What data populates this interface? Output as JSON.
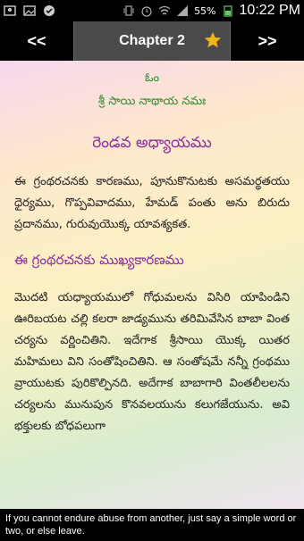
{
  "status": {
    "battery": "55%",
    "time": "10:22 PM"
  },
  "toolbar": {
    "prev_label": "<<",
    "title": "Chapter 2",
    "next_label": ">>"
  },
  "content": {
    "om": "ఓం",
    "mantra": "శ్రీ సాయి నాథాయ నమః",
    "chapter_heading": "రెండవ అధ్యాయము",
    "para1": "ఈ గ్రంథరచనకు కారణము, పూనుకొనుటకు అసమర్థతయు ధైర్యము, గొప్పవివాదము, హేమడ్ పంతు అను బిరుదు ప్రదానము, గురువుయొక్క యావశ్యకత.",
    "section_heading": "ఈ గ్రంథరచనకు ముఖ్యకారణము",
    "para2": "మొదటి యధ్యాయములో గోధుమలను విసిరి యాపిండిని ఊరిబయట చల్లి కలరా జాడ్యమును తరిమివేసిన బాబా వింత చర్యను వర్ణించితిని. ఇదేగాక శ్రీసాయి యొక్క యితర మహిమలు విని సంతోషించితిని. ఆ సంతోషమే నన్నీ గ్రంథము వ్రాయుటకు పురికొల్పినది. అదేగాక బాబాగారి వింతలీలలను చర్యలను మునుపున కొనవలయును కలుగజేయును. అవి భక్తులకు బోధపలుగా"
  },
  "footer": {
    "quote": "If you cannot endure abuse from another, just say a simple word or two, or else leave."
  },
  "colors": {
    "green_text": "#2a8a2a",
    "purple_heading": "#8a2aa0",
    "star_gold": "#f2b41b"
  }
}
